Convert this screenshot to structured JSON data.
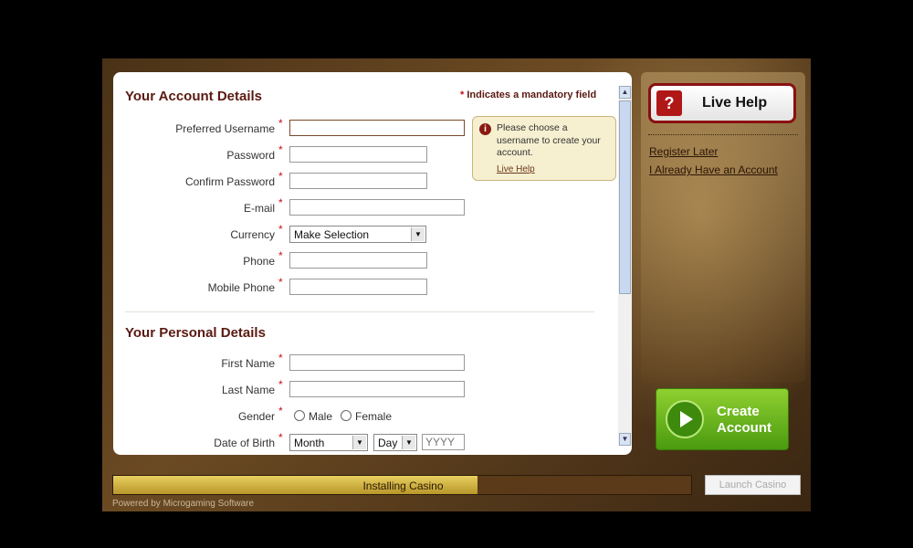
{
  "account_section": {
    "title": "Your Account Details",
    "mandatory_star": "*",
    "mandatory_note": "Indicates a mandatory field",
    "fields": [
      {
        "label": "Preferred Username",
        "value": ""
      },
      {
        "label": "Password",
        "value": ""
      },
      {
        "label": "Confirm Password",
        "value": ""
      },
      {
        "label": "E-mail",
        "value": ""
      },
      {
        "label": "Currency",
        "value": "Make Selection"
      },
      {
        "label": "Phone",
        "value": ""
      },
      {
        "label": "Mobile Phone",
        "value": ""
      }
    ]
  },
  "tip": {
    "text": "Please choose a username to create your account.",
    "link": "Live Help",
    "icon": "info-icon"
  },
  "personal_section": {
    "title": "Your Personal Details",
    "fields": [
      {
        "label": "First Name",
        "value": ""
      },
      {
        "label": "Last Name",
        "value": ""
      },
      {
        "label": "Gender"
      },
      {
        "label": "Date of Birth"
      }
    ],
    "gender_options": [
      "Male",
      "Female"
    ],
    "dob": {
      "month": "Month",
      "day": "Day",
      "year_placeholder": "YYYY"
    }
  },
  "required_marker": "*",
  "side": {
    "live_help": "Live Help",
    "live_help_icon": "?",
    "register_later": "Register Later",
    "already_have_account": "I Already Have an Account",
    "create_account_line1": "Create",
    "create_account_line2": "Account"
  },
  "footer": {
    "progress_label": "Installing Casino",
    "progress_percent": 63,
    "launch_button": "Launch Casino",
    "powered_by": "Powered by Microgaming Software"
  },
  "colors": {
    "accent": "#5a1a12",
    "required": "#c81010",
    "create_green": "#6ab820",
    "progress_fill": "#d4b648"
  }
}
